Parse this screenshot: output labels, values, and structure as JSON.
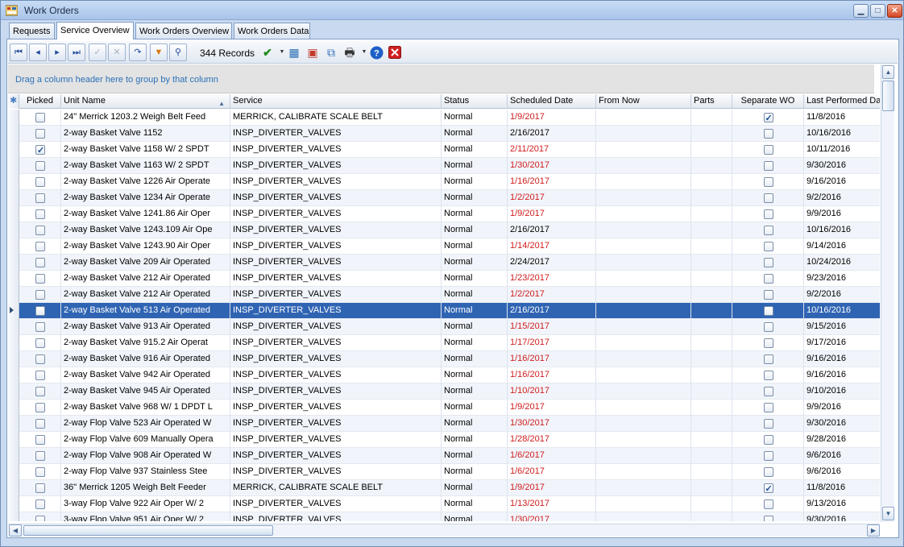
{
  "window": {
    "title": "Work Orders"
  },
  "tabs": [
    {
      "label": "Requests"
    },
    {
      "label": "Service Overview"
    },
    {
      "label": "Work Orders Overview"
    },
    {
      "label": "Work Orders Data"
    }
  ],
  "toolbar": {
    "records": "344 Records"
  },
  "groupbar": {
    "text": "Drag a column header here to group by that column"
  },
  "grid": {
    "columns": [
      "Picked",
      "Unit Name",
      "Service",
      "Status",
      "Scheduled Date",
      "From Now",
      "Parts",
      "Separate WO",
      "Last Performed Dat"
    ],
    "rows": [
      {
        "picked": false,
        "unit": "24\" Merrick 1203.2  Weigh Belt Feed",
        "service": "MERRICK, CALIBRATE SCALE BELT",
        "status": "Normal",
        "date": "1/9/2017",
        "overdue": true,
        "sep": true,
        "last": "11/8/2016"
      },
      {
        "picked": false,
        "unit": "2-way Basket Valve 1152",
        "service": "INSP_DIVERTER_VALVES",
        "status": "Normal",
        "date": "2/16/2017",
        "overdue": false,
        "sep": false,
        "last": "10/16/2016"
      },
      {
        "picked": true,
        "unit": "2-way Basket Valve 1158  W/ 2 SPDT",
        "service": "INSP_DIVERTER_VALVES",
        "status": "Normal",
        "date": "2/11/2017",
        "overdue": true,
        "sep": false,
        "last": "10/11/2016"
      },
      {
        "picked": false,
        "unit": "2-way Basket Valve 1163  W/ 2 SPDT",
        "service": "INSP_DIVERTER_VALVES",
        "status": "Normal",
        "date": "1/30/2017",
        "overdue": true,
        "sep": false,
        "last": "9/30/2016"
      },
      {
        "picked": false,
        "unit": "2-way Basket Valve 1226 Air Operate",
        "service": "INSP_DIVERTER_VALVES",
        "status": "Normal",
        "date": "1/16/2017",
        "overdue": true,
        "sep": false,
        "last": "9/16/2016"
      },
      {
        "picked": false,
        "unit": "2-way Basket Valve 1234 Air Operate",
        "service": "INSP_DIVERTER_VALVES",
        "status": "Normal",
        "date": "1/2/2017",
        "overdue": true,
        "sep": false,
        "last": "9/2/2016"
      },
      {
        "picked": false,
        "unit": "2-way Basket Valve 1241.86 Air Oper",
        "service": "INSP_DIVERTER_VALVES",
        "status": "Normal",
        "date": "1/9/2017",
        "overdue": true,
        "sep": false,
        "last": "9/9/2016"
      },
      {
        "picked": false,
        "unit": "2-way Basket Valve 1243.109 Air Ope",
        "service": "INSP_DIVERTER_VALVES",
        "status": "Normal",
        "date": "2/16/2017",
        "overdue": false,
        "sep": false,
        "last": "10/16/2016"
      },
      {
        "picked": false,
        "unit": "2-way Basket Valve 1243.90 Air Oper",
        "service": "INSP_DIVERTER_VALVES",
        "status": "Normal",
        "date": "1/14/2017",
        "overdue": true,
        "sep": false,
        "last": "9/14/2016"
      },
      {
        "picked": false,
        "unit": "2-way Basket Valve 209 Air Operated",
        "service": "INSP_DIVERTER_VALVES",
        "status": "Normal",
        "date": "2/24/2017",
        "overdue": false,
        "sep": false,
        "last": "10/24/2016"
      },
      {
        "picked": false,
        "unit": "2-way Basket Valve 212 Air Operated",
        "service": "INSP_DIVERTER_VALVES",
        "status": "Normal",
        "date": "1/23/2017",
        "overdue": true,
        "sep": false,
        "last": "9/23/2016"
      },
      {
        "picked": false,
        "unit": "2-way Basket Valve 212 Air Operated",
        "service": "INSP_DIVERTER_VALVES",
        "status": "Normal",
        "date": "1/2/2017",
        "overdue": true,
        "sep": false,
        "last": "9/2/2016"
      },
      {
        "picked": false,
        "unit": "2-way Basket Valve 513 Air Operated",
        "service": "INSP_DIVERTER_VALVES",
        "status": "Normal",
        "date": "2/16/2017",
        "overdue": false,
        "sep": false,
        "last": "10/16/2016",
        "selected": true
      },
      {
        "picked": false,
        "unit": "2-way Basket Valve 913 Air Operated",
        "service": "INSP_DIVERTER_VALVES",
        "status": "Normal",
        "date": "1/15/2017",
        "overdue": true,
        "sep": false,
        "last": "9/15/2016"
      },
      {
        "picked": false,
        "unit": "2-way Basket Valve 915.2 Air Operat",
        "service": "INSP_DIVERTER_VALVES",
        "status": "Normal",
        "date": "1/17/2017",
        "overdue": true,
        "sep": false,
        "last": "9/17/2016"
      },
      {
        "picked": false,
        "unit": "2-way Basket Valve 916 Air Operated",
        "service": "INSP_DIVERTER_VALVES",
        "status": "Normal",
        "date": "1/16/2017",
        "overdue": true,
        "sep": false,
        "last": "9/16/2016"
      },
      {
        "picked": false,
        "unit": "2-way Basket Valve 942 Air Operated",
        "service": "INSP_DIVERTER_VALVES",
        "status": "Normal",
        "date": "1/16/2017",
        "overdue": true,
        "sep": false,
        "last": "9/16/2016"
      },
      {
        "picked": false,
        "unit": "2-way Basket Valve 945 Air Operated",
        "service": "INSP_DIVERTER_VALVES",
        "status": "Normal",
        "date": "1/10/2017",
        "overdue": true,
        "sep": false,
        "last": "9/10/2016"
      },
      {
        "picked": false,
        "unit": "2-way Basket Valve 968  W/ 1 DPDT L",
        "service": "INSP_DIVERTER_VALVES",
        "status": "Normal",
        "date": "1/9/2017",
        "overdue": true,
        "sep": false,
        "last": "9/9/2016"
      },
      {
        "picked": false,
        "unit": "2-way Flop Valve 523 Air Operated W",
        "service": "INSP_DIVERTER_VALVES",
        "status": "Normal",
        "date": "1/30/2017",
        "overdue": true,
        "sep": false,
        "last": "9/30/2016"
      },
      {
        "picked": false,
        "unit": "2-way Flop Valve 609 Manually Opera",
        "service": "INSP_DIVERTER_VALVES",
        "status": "Normal",
        "date": "1/28/2017",
        "overdue": true,
        "sep": false,
        "last": "9/28/2016"
      },
      {
        "picked": false,
        "unit": "2-way Flop Valve 908 Air Operated W",
        "service": "INSP_DIVERTER_VALVES",
        "status": "Normal",
        "date": "1/6/2017",
        "overdue": true,
        "sep": false,
        "last": "9/6/2016"
      },
      {
        "picked": false,
        "unit": "2-way Flop Valve 937 Stainless Stee",
        "service": "INSP_DIVERTER_VALVES",
        "status": "Normal",
        "date": "1/6/2017",
        "overdue": true,
        "sep": false,
        "last": "9/6/2016"
      },
      {
        "picked": false,
        "unit": "36\" Merrick 1205  Weigh Belt Feeder",
        "service": "MERRICK, CALIBRATE SCALE BELT",
        "status": "Normal",
        "date": "1/9/2017",
        "overdue": true,
        "sep": true,
        "last": "11/8/2016"
      },
      {
        "picked": false,
        "unit": "3-way Flop Valve 922 Air Oper W/ 2",
        "service": "INSP_DIVERTER_VALVES",
        "status": "Normal",
        "date": "1/13/2017",
        "overdue": true,
        "sep": false,
        "last": "9/13/2016"
      },
      {
        "picked": false,
        "unit": "3-way Flop Valve 951 Air Oper W/ 2",
        "service": "INSP_DIVERTER_VALVES",
        "status": "Normal",
        "date": "1/30/2017",
        "overdue": true,
        "sep": false,
        "last": "9/30/2016"
      }
    ]
  }
}
